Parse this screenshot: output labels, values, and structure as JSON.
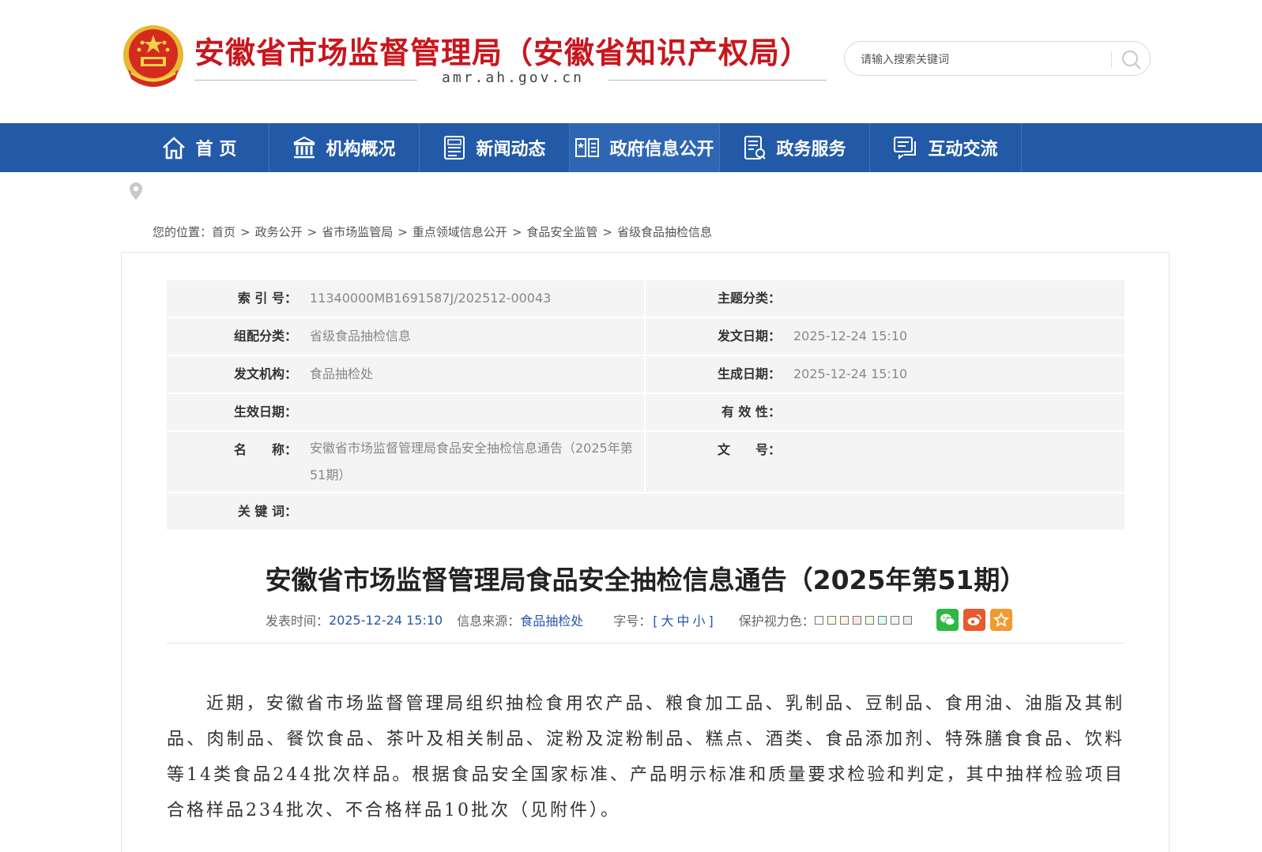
{
  "header": {
    "site_title": "安徽省市场监督管理局（安徽省知识产权局）",
    "site_domain": "amr.ah.gov.cn",
    "search_placeholder": "请输入搜索关键词"
  },
  "nav": {
    "items": [
      {
        "label": "首 页",
        "icon": "home-icon"
      },
      {
        "label": "机构概况",
        "icon": "institution-icon"
      },
      {
        "label": "新闻动态",
        "icon": "news-icon"
      },
      {
        "label": "政府信息公开",
        "icon": "open-book-icon"
      },
      {
        "label": "政务服务",
        "icon": "service-doc-icon"
      },
      {
        "label": "互动交流",
        "icon": "chat-icon"
      }
    ],
    "active_index": 3
  },
  "breadcrumb": {
    "prefix": "您的位置：",
    "items": [
      "首页",
      "政务公开",
      "省市场监管局",
      "重点领域信息公开",
      "食品安全监管",
      "省级食品抽检信息"
    ],
    "separator": ">"
  },
  "meta": {
    "index_no_label": "索 引 号：",
    "index_no": "11340000MB1691587J/202512-00043",
    "topic_label": "主题分类：",
    "topic": "",
    "category_label": "组配分类：",
    "category": "省级食品抽检信息",
    "issue_date_label": "发文日期：",
    "issue_date": "2025-12-24 15:10",
    "agency_label": "发文机构：",
    "agency": "食品抽检处",
    "created_date_label": "生成日期：",
    "created_date": "2025-12-24 15:10",
    "effective_date_label": "生效日期：",
    "effective_date": "",
    "validity_label": "有 效 性：",
    "validity": "",
    "name_label": "名　　称：",
    "name": "安徽省市场监督管理局食品安全抽检信息通告（2025年第51期）",
    "doc_no_label": "文　　号：",
    "doc_no": "",
    "keywords_label": "关 键 词：",
    "keywords": ""
  },
  "article": {
    "title": "安徽省市场监督管理局食品安全抽检信息通告（2025年第51期）",
    "publish_label": "发表时间：",
    "publish_time": "2025-12-24 15:10",
    "source_label": "信息来源：",
    "source": "食品抽检处",
    "font_label": "字号：",
    "font_open": "[",
    "font_large": "大",
    "font_medium": "中",
    "font_small": "小",
    "font_close": "]",
    "eye_care_label": "保护视力色：",
    "eye_care_colors": [
      "#ffffff",
      "#fafbe6",
      "#fff2e2",
      "#fde6e0",
      "#f3ffe1",
      "#dafaf8",
      "#f2f4f4",
      "#eaeaef"
    ],
    "share_colors": {
      "wechat": "#2fb844",
      "weibo": "#e9592b",
      "favorite": "#f29a2d"
    },
    "body": "近期，安徽省市场监督管理局组织抽检食用农产品、粮食加工品、乳制品、豆制品、食用油、油脂及其制品、肉制品、餐饮食品、茶叶及相关制品、淀粉及淀粉制品、糕点、酒类、食品添加剂、特殊膳食食品、饮料等14类食品244批次样品。根据食品安全国家标准、产品明示标准和质量要求检验和判定，其中抽样检验项目合格样品234批次、不合格样品10批次（见附件）。"
  },
  "colors": {
    "brand_red": "#c8161d",
    "nav_blue": "#235aa8",
    "link_blue": "#2557a6"
  }
}
